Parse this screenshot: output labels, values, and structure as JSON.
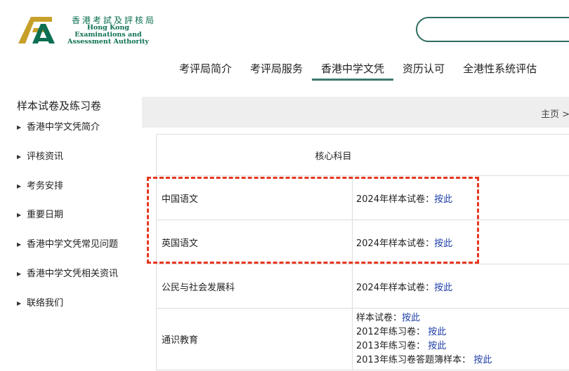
{
  "logo": {
    "name_zh": "香港考試及評核局",
    "name_en_line1": "Hong Kong",
    "name_en_line2": "Examinations and",
    "name_en_line3": "Assessment Authority"
  },
  "search": {
    "value": "",
    "placeholder": ""
  },
  "nav": {
    "items": [
      {
        "label": "考评局简介",
        "active": false
      },
      {
        "label": "考评局服务",
        "active": false
      },
      {
        "label": "香港中学文凭",
        "active": true
      },
      {
        "label": "资历认可",
        "active": false
      },
      {
        "label": "全港性系统评估",
        "active": false
      }
    ]
  },
  "sidebar": {
    "title": "样本试卷及练习卷",
    "items": [
      {
        "label": "香港中学文凭简介"
      },
      {
        "label": "评核资讯"
      },
      {
        "label": "考务安排"
      },
      {
        "label": "重要日期"
      },
      {
        "label": "香港中学文凭常见问题"
      },
      {
        "label": "香港中学文凭相关资讯"
      },
      {
        "label": "联络我们"
      }
    ]
  },
  "breadcrumb": {
    "text": "主页 >"
  },
  "table": {
    "header": "核心科目",
    "rows": [
      {
        "subject": "中国语文",
        "prefix": "2024年样本试卷：",
        "link": "按此"
      },
      {
        "subject": "英国语文",
        "prefix": "2024年样本试卷：",
        "link": "按此"
      },
      {
        "subject": "公民与社会发展科",
        "prefix": "2024年样本试卷：",
        "link": "按此"
      }
    ],
    "liberal": {
      "subject": "通识教育",
      "lines": [
        {
          "prefix": "样本试卷：",
          "link": "按此"
        },
        {
          "prefix": "2012年练习卷： ",
          "link": "按此"
        },
        {
          "prefix": "2013年练习卷： ",
          "link": "按此"
        },
        {
          "prefix": "2013年练习卷答题簿样本： ",
          "link": "按此"
        }
      ]
    }
  },
  "colors": {
    "brand_green": "#0c6f52",
    "nav_underline": "#3d7a6d",
    "link_blue": "#1f3fa9",
    "highlight_red": "#e8361f",
    "crumb_bg": "#eeeeee"
  }
}
